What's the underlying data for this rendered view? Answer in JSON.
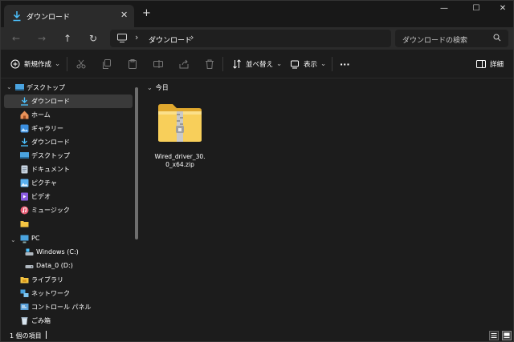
{
  "tab": {
    "title": "ダウンロード",
    "close": "✕"
  },
  "new_tab": "+",
  "window": {
    "minimize": "—",
    "maximize": "☐",
    "close": "✕"
  },
  "nav": {
    "back": "←",
    "forward": "→",
    "up": "↑",
    "refresh": "↻"
  },
  "address": {
    "crumb": "ダウンロード",
    "sep": "›"
  },
  "search": {
    "placeholder": "ダウンロードの検索"
  },
  "toolbar": {
    "new_label": "新規作成",
    "sort_label": "並べ替え",
    "view_label": "表示",
    "more": "···",
    "details_label": "詳細"
  },
  "sidebar": {
    "items": [
      {
        "label": "デスクトップ",
        "icon": "desktop-icon"
      },
      {
        "label": "ダウンロード",
        "icon": "download-icon"
      },
      {
        "label": "ホーム",
        "icon": "home-icon"
      },
      {
        "label": "ギャラリー",
        "icon": "gallery-icon"
      },
      {
        "label": "ダウンロード",
        "icon": "download-icon"
      },
      {
        "label": "デスクトップ",
        "icon": "desktop-icon"
      },
      {
        "label": "ドキュメント",
        "icon": "document-icon"
      },
      {
        "label": "ピクチャ",
        "icon": "pictures-icon"
      },
      {
        "label": "ビデオ",
        "icon": "video-icon"
      },
      {
        "label": "ミュージック",
        "icon": "music-icon"
      },
      {
        "label": "",
        "icon": "folder-icon"
      },
      {
        "label": "PC",
        "icon": "pc-icon"
      },
      {
        "label": "Windows (C:)",
        "icon": "drive-icon"
      },
      {
        "label": "Data_0 (D:)",
        "icon": "drive-icon"
      },
      {
        "label": "ライブラリ",
        "icon": "library-icon"
      },
      {
        "label": "ネットワーク",
        "icon": "network-icon"
      },
      {
        "label": "コントロール パネル",
        "icon": "control-panel-icon"
      },
      {
        "label": "ごみ箱",
        "icon": "recycle-bin-icon"
      }
    ]
  },
  "content": {
    "group": "今日",
    "files": [
      {
        "name": "Wired_driver_30.0_x64.zip",
        "icon": "zip-folder-icon"
      }
    ]
  },
  "status": {
    "count": "1 個の項目"
  },
  "colors": {
    "accent": "#4cc2ff",
    "folder": "#f5c542",
    "selected": "#3a3a3a"
  }
}
